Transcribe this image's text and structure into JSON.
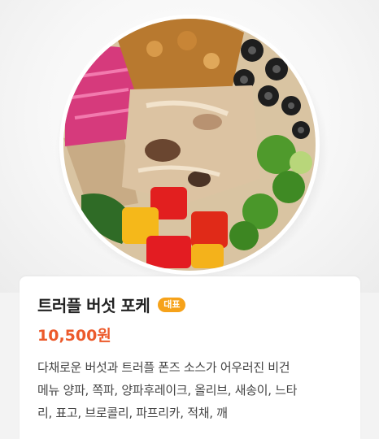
{
  "product": {
    "name": "트러플 버섯 포케",
    "badge": "대표",
    "price": "10,500원",
    "description_lines": [
      "다채로운 버섯과 트러플 폰즈 소스가 어우러진 비건",
      "메뉴 양파, 쪽파, 양파후레이크, 올리브, 새송이, 느타",
      "리, 표고, 브로콜리, 파프리카, 적채, 깨"
    ]
  },
  "colors": {
    "price": "#ec5a2b",
    "badge": "#f6a21a"
  }
}
